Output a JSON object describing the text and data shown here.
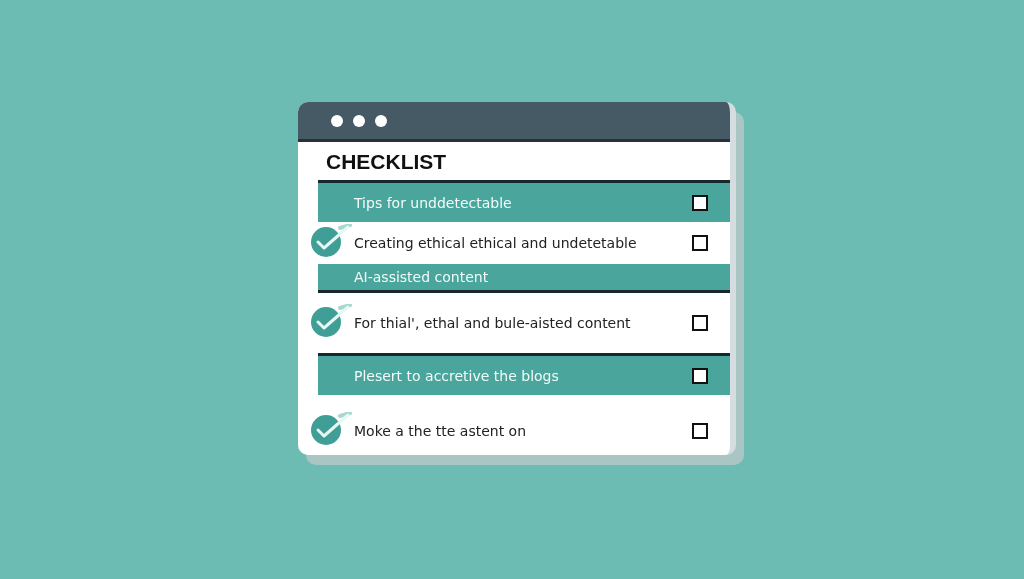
{
  "window": {
    "title": "CHECKLIST"
  },
  "items": [
    {
      "kind": "band",
      "label": "Tips for unddetectable",
      "checked": false
    },
    {
      "kind": "row",
      "label": "Creating ethical ethical and undetetable",
      "done": true,
      "checked": false
    },
    {
      "kind": "band-note",
      "label": "AI-assisted content"
    },
    {
      "kind": "row",
      "label": "For thial', ethal and bule-aisted content",
      "done": true,
      "checked": false
    },
    {
      "kind": "band",
      "label": "Plesert to accretive the blogs",
      "checked": false
    },
    {
      "kind": "row",
      "label": "Moke a the tte astent on",
      "done": true,
      "checked": false
    }
  ]
}
